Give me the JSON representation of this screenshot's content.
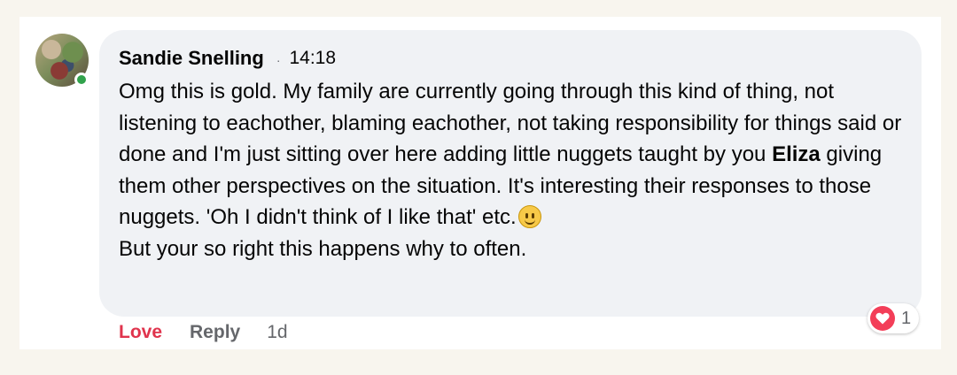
{
  "comment": {
    "author": "Sandie Snelling",
    "separator": "·",
    "time": "14:18",
    "text_parts": {
      "before_name": "Omg this is gold. My family are currently going through this kind of thing, not listening to eachother, blaming eachother, not taking responsibility for things said or done and I'm just sitting over here adding little nuggets taught by you ",
      "mention": "Eliza",
      "after_name": " giving them other perspectives on the situation. It's interesting their responses to those nuggets. 'Oh I didn't think of I like that' etc.",
      "last_line": "But your so right this happens why to often."
    },
    "emoji_icon": "slightly-smiling-face-icon"
  },
  "actions": {
    "love_label": "Love",
    "reply_label": "Reply",
    "age": "1d"
  },
  "reaction": {
    "icon": "heart-icon",
    "count": "1",
    "color": "#f33e58"
  },
  "colors": {
    "page_background": "#f8f5ee",
    "bubble_background": "#f0f2f5",
    "love_color": "#e0344d",
    "online_color": "#31a24c"
  }
}
